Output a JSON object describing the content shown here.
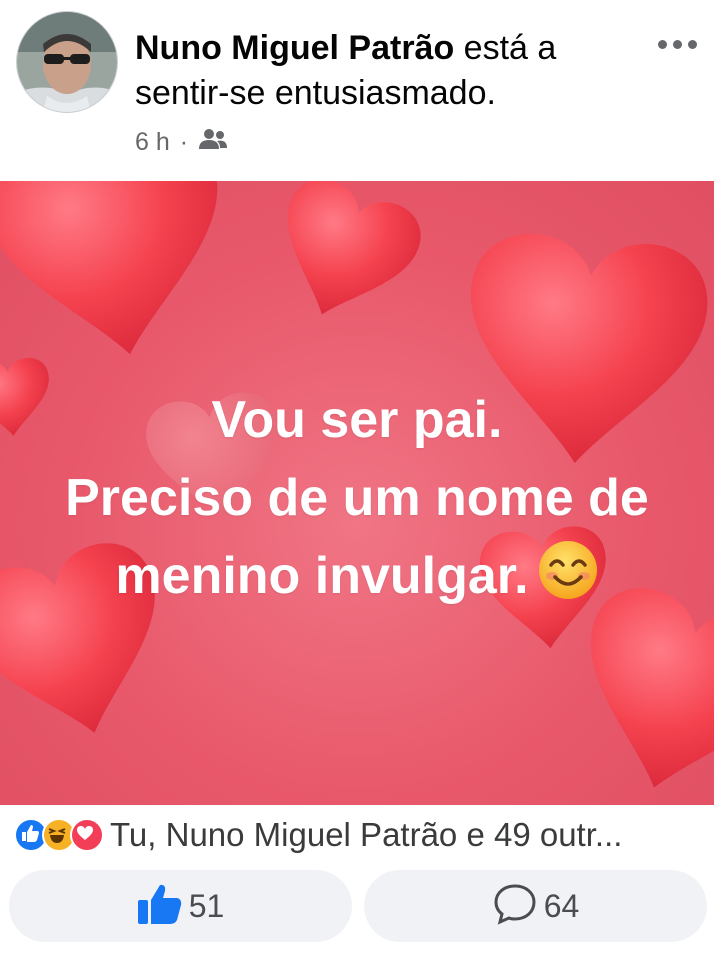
{
  "post": {
    "author_name": "Nuno Miguel Patrão",
    "feeling_text": " está a sentir-se entusiasmado.",
    "timestamp": "6 h",
    "separator": "·",
    "audience_icon": "friends-icon",
    "more_icon": "more-options-icon",
    "caption_lines": [
      "Vou ser pai.",
      "Preciso de um nome de",
      "menino invulgar."
    ],
    "caption_emoji": "smiling-face-icon",
    "background_color": "#e8596b",
    "heart_color": "#f5424f"
  },
  "reactions": {
    "icons": [
      "like-reaction-icon",
      "haha-reaction-icon",
      "love-reaction-icon"
    ],
    "summary": "Tu, Nuno Miguel Patrão e 49 outr..."
  },
  "actions": {
    "like_count": "51",
    "comment_count": "64",
    "like_icon": "thumbs-up-icon",
    "comment_icon": "comment-icon",
    "accent": "#1877f2"
  }
}
